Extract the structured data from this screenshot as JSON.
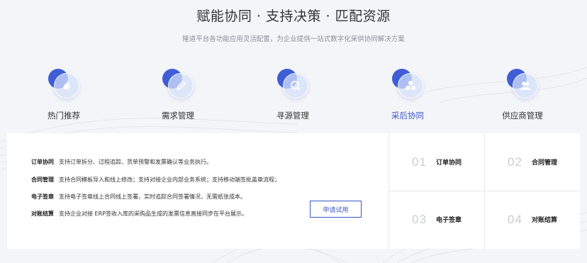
{
  "header": {
    "title": "赋能协同 · 支持决策 · 匹配资源",
    "subtitle": "隆道平台各功能应用灵活配置，为企业提供一站式数字化采供协同解决方案"
  },
  "categories": [
    {
      "label": "热门推荐",
      "icon": "flame-icon"
    },
    {
      "label": "需求管理",
      "icon": "pencil-icon"
    },
    {
      "label": "寻源管理",
      "icon": "magnifier-icon"
    },
    {
      "label": "采后协同",
      "icon": "collaboration-icon",
      "active": true
    },
    {
      "label": "供应商管理",
      "icon": "users-icon"
    }
  ],
  "accent_color": "#3b57c8",
  "features": [
    {
      "name": "订单协同",
      "desc": "支持订单拆分、过程追踪、货单预警和发票确认等业务执行。"
    },
    {
      "name": "合同管理",
      "desc": "支持合同模板导入和线上修改；支持对接企业内部业务系统；支持移动端签批盖章流程；"
    },
    {
      "name": "电子签章",
      "desc": "支持电子签章线上合同线上签署，实时追踪合同签署情况，无需纸张成本。"
    },
    {
      "name": "对账结算",
      "desc": "支持企业对接 ERP签收入库的采购品生成的发票信息直接同步在平台展示。"
    }
  ],
  "trial_button": "申请试用",
  "grid": [
    {
      "num": "01",
      "name": "订单协同"
    },
    {
      "num": "02",
      "name": "合同管理"
    },
    {
      "num": "03",
      "name": "电子签章"
    },
    {
      "num": "04",
      "name": "对账结算"
    }
  ]
}
